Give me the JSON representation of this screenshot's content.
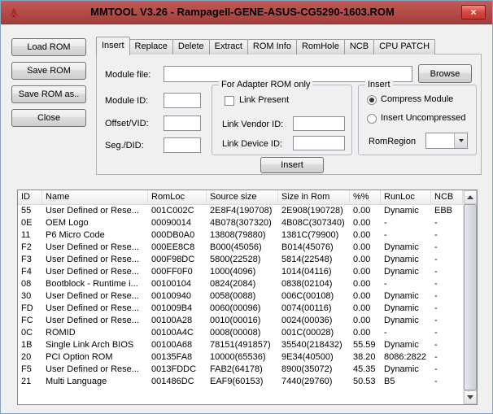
{
  "window": {
    "title": "MMTOOL V3.26 - RampageII-GENE-ASUS-CG5290-1603.ROM",
    "close_glyph": "×",
    "colors": {
      "titlebar": "#b24a46",
      "close_button": "#dd4742",
      "window_border": "#86a5c8"
    }
  },
  "sidebar": {
    "buttons": [
      {
        "label": "Load ROM"
      },
      {
        "label": "Save ROM"
      },
      {
        "label": "Save ROM as.."
      },
      {
        "label": "Close"
      }
    ]
  },
  "tabs": [
    {
      "label": "Insert",
      "selected": true
    },
    {
      "label": "Replace",
      "selected": false
    },
    {
      "label": "Delete",
      "selected": false
    },
    {
      "label": "Extract",
      "selected": false
    },
    {
      "label": "ROM Info",
      "selected": false
    },
    {
      "label": "RomHole",
      "selected": false
    },
    {
      "label": "NCB",
      "selected": false
    },
    {
      "label": "CPU PATCH",
      "selected": false
    }
  ],
  "insert_tab": {
    "module_file": {
      "label": "Module file:",
      "value": ""
    },
    "browse_label": "Browse",
    "module_id": {
      "label": "Module ID:",
      "value": ""
    },
    "offset_vid": {
      "label": "Offset/VID:",
      "value": ""
    },
    "seg_did": {
      "label": "Seg./DID:",
      "value": ""
    },
    "adapter_group": {
      "title": "For Adapter ROM only",
      "link_present": {
        "label": "Link Present",
        "checked": false
      },
      "link_vendor": {
        "label": "Link Vendor ID:",
        "value": ""
      },
      "link_device": {
        "label": "Link Device ID:",
        "value": ""
      }
    },
    "insert_group": {
      "title": "Insert",
      "compress_module": {
        "label": "Compress Module",
        "selected": true
      },
      "insert_uncompressed": {
        "label": "Insert Uncompressed",
        "selected": false
      },
      "rom_region": {
        "label": "RomRegion",
        "value": ""
      }
    },
    "insert_button": "Insert"
  },
  "module_table": {
    "columns": [
      "ID",
      "Name",
      "RomLoc",
      "Source size",
      "Size in Rom",
      "%%",
      "RunLoc",
      "NCB"
    ],
    "rows": [
      [
        "55",
        "User Defined or Rese...",
        "001C002C",
        "2E8F4(190708)",
        "2E908(190728)",
        "0.00",
        "Dynamic",
        "EBB"
      ],
      [
        "0E",
        "OEM Logo",
        "00090014",
        "4B078(307320)",
        "4B08C(307340)",
        "0.00",
        "-",
        "-"
      ],
      [
        "11",
        "P6 Micro Code",
        "000DB0A0",
        "13808(79880)",
        "1381C(79900)",
        "0.00",
        "-",
        "-"
      ],
      [
        "F2",
        "User Defined or Rese...",
        "000EE8C8",
        "B000(45056)",
        "B014(45076)",
        "0.00",
        "Dynamic",
        "-"
      ],
      [
        "F3",
        "User Defined or Rese...",
        "000F98DC",
        "5800(22528)",
        "5814(22548)",
        "0.00",
        "Dynamic",
        "-"
      ],
      [
        "F4",
        "User Defined or Rese...",
        "000FF0F0",
        "1000(4096)",
        "1014(04116)",
        "0.00",
        "Dynamic",
        "-"
      ],
      [
        "08",
        "Bootblock - Runtime i...",
        "00100104",
        "0824(2084)",
        "0838(02104)",
        "0.00",
        "-",
        "-"
      ],
      [
        "30",
        "User Defined or Rese...",
        "00100940",
        "0058(0088)",
        "006C(00108)",
        "0.00",
        "Dynamic",
        "-"
      ],
      [
        "FD",
        "User Defined or Rese...",
        "001009B4",
        "0060(00096)",
        "0074(00116)",
        "0.00",
        "Dynamic",
        "-"
      ],
      [
        "FC",
        "User Defined or Rese...",
        "00100A28",
        "0010(00016)",
        "0024(00036)",
        "0.00",
        "Dynamic",
        "-"
      ],
      [
        "0C",
        "ROMID",
        "00100A4C",
        "0008(00008)",
        "001C(00028)",
        "0.00",
        "-",
        "-"
      ],
      [
        "1B",
        "Single Link Arch BIOS",
        "00100A68",
        "78151(491857)",
        "35540(218432)",
        "55.59",
        "Dynamic",
        "-"
      ],
      [
        "20",
        "PCI Option ROM",
        "00135FA8",
        "10000(65536)",
        "9E34(40500)",
        "38.20",
        "8086:2822",
        "-"
      ],
      [
        "F5",
        "User Defined or Rese...",
        "0013FDDC",
        "FAB2(64178)",
        "8900(35072)",
        "45.35",
        "Dynamic",
        "-"
      ],
      [
        "21",
        "Multi Language",
        "001486DC",
        "EAF9(60153)",
        "7440(29760)",
        "50.53",
        "B5",
        "-"
      ]
    ]
  }
}
